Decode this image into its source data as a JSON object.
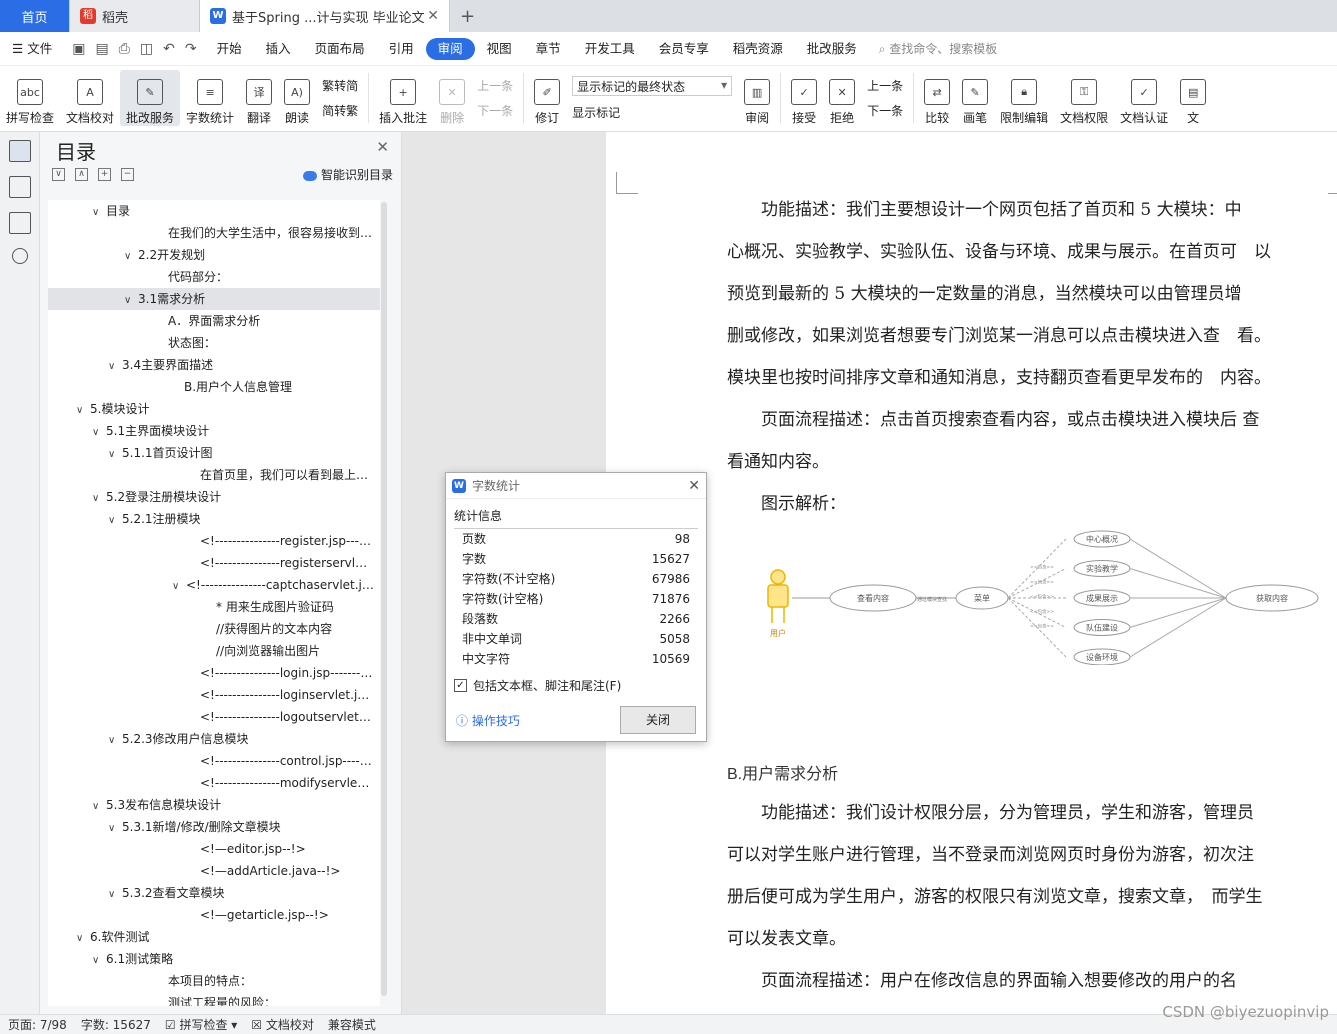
{
  "tabs": {
    "home": "首页",
    "daoke": "稻壳",
    "doc": "基于Spring ...计与实现 毕业论文"
  },
  "menu": {
    "file": "文件",
    "items": [
      "开始",
      "插入",
      "页面布局",
      "引用",
      "审阅",
      "视图",
      "章节",
      "开发工具",
      "会员专享",
      "稻壳资源",
      "批改服务"
    ],
    "active": "审阅",
    "search": "查找命令、搜索模板"
  },
  "ribbon": {
    "spell": "拼写检查",
    "doc_check": "文档校对",
    "correct": "批改服务",
    "word_count": "字数统计",
    "translate": "翻译",
    "read": "朗读",
    "to_trad": "繁转简",
    "to_simp": "简转繁",
    "insert_comment": "插入批注",
    "delete": "删除",
    "prev1": "上一条",
    "next1": "下一条",
    "revise": "修订",
    "show_state": "显示标记的最终状态",
    "show_mark": "显示标记",
    "review": "审阅",
    "accept": "接受",
    "reject": "拒绝",
    "prev2": "上一条",
    "next2": "下一条",
    "compare": "比较",
    "pen": "画笔",
    "limit_edit": "限制编辑",
    "doc_perm": "文档权限",
    "doc_auth": "文档认证",
    "more": "文"
  },
  "toc": {
    "title": "目录",
    "smart": "智能识别目录",
    "items": [
      {
        "label": "目录",
        "arrow": "∨",
        "indent": 44
      },
      {
        "label": "在我们的大学生活中，很容易接收到不同渠道的消息",
        "arrow": "",
        "indent": 106
      },
      {
        "label": "2.2开发规划",
        "arrow": "∨",
        "indent": 76
      },
      {
        "label": "代码部分：",
        "arrow": "",
        "indent": 106
      },
      {
        "label": "3.1需求分析",
        "arrow": "∨",
        "indent": 76,
        "selected": true
      },
      {
        "label": "A．界面需求分析",
        "arrow": "",
        "indent": 106
      },
      {
        "label": "状态图：",
        "arrow": "",
        "indent": 106
      },
      {
        "label": "3.4主要界面描述",
        "arrow": "∨",
        "indent": 60
      },
      {
        "label": "B.用户个人信息管理",
        "arrow": "",
        "indent": 122
      },
      {
        "label": "5.模块设计",
        "arrow": "∨",
        "indent": 28
      },
      {
        "label": "5.1主界面模块设计",
        "arrow": "∨",
        "indent": 44
      },
      {
        "label": "5.1.1首页设计图",
        "arrow": "∨",
        "indent": 60
      },
      {
        "label": "在首页里，我们可以看到最上方的导航栏",
        "arrow": "",
        "indent": 138
      },
      {
        "label": "5.2登录注册模块设计",
        "arrow": "∨",
        "indent": 44
      },
      {
        "label": "5.2.1注册模块",
        "arrow": "∨",
        "indent": 60
      },
      {
        "label": "<!---------------register.jsp-------------->",
        "arrow": "",
        "indent": 138
      },
      {
        "label": "<!---------------registerservlet.java-------->",
        "arrow": "",
        "indent": 138
      },
      {
        "label": "<!---------------captchaservlet.java-------->",
        "arrow": "∨",
        "indent": 124
      },
      {
        "label": "* 用来生成图片验证码",
        "arrow": "",
        "indent": 154
      },
      {
        "label": "//获得图片的文本内容",
        "arrow": "",
        "indent": 154
      },
      {
        "label": "//向浏览器输出图片",
        "arrow": "",
        "indent": 154
      },
      {
        "label": "<!---------------login.jsp---------------->",
        "arrow": "",
        "indent": 138
      },
      {
        "label": "<!---------------loginservlet.java---------->",
        "arrow": "",
        "indent": 138
      },
      {
        "label": "<!---------------logoutservlet-------------->",
        "arrow": "",
        "indent": 138
      },
      {
        "label": "5.2.3修改用户信息模块",
        "arrow": "∨",
        "indent": 60
      },
      {
        "label": "<!---------------control.jsp---------------->",
        "arrow": "",
        "indent": 138
      },
      {
        "label": "<!---------------modifyservlet.java-------->",
        "arrow": "",
        "indent": 138
      },
      {
        "label": "5.3发布信息模块设计",
        "arrow": "∨",
        "indent": 44
      },
      {
        "label": "5.3.1新增/修改/删除文章模块",
        "arrow": "∨",
        "indent": 60
      },
      {
        "label": "<!—editor.jsp--!>",
        "arrow": "",
        "indent": 138
      },
      {
        "label": "<!—addArticle.java--!>",
        "arrow": "",
        "indent": 138
      },
      {
        "label": "5.3.2查看文章模块",
        "arrow": "∨",
        "indent": 60
      },
      {
        "label": "<!—getarticle.jsp--!>",
        "arrow": "",
        "indent": 138
      },
      {
        "label": "6.软件测试",
        "arrow": "∨",
        "indent": 28
      },
      {
        "label": "6.1测试策略",
        "arrow": "∨",
        "indent": 44
      },
      {
        "label": "本项目的特点：",
        "arrow": "",
        "indent": 106
      },
      {
        "label": "测试工程量的风险：",
        "arrow": "",
        "indent": 106
      }
    ]
  },
  "doc": {
    "p1": [
      "　　功能描述：我们主要想设计一个网页包括了首页和 5 大模块：中",
      "心概况、实验教学、实验队伍、设备与环境、成果与展示。在首页可　以",
      "预览到最新的 5 大模块的一定数量的消息，当然模块可以由管理员增",
      "删或修改，如果浏览者想要专门浏览某一消息可以点击模块进入查　看。",
      "模块里也按时间排序文章和通知消息，支持翻页查看更早发布的　内容。"
    ],
    "p2": [
      "　　页面流程描述：点击首页搜索查看内容，或点击模块进入模块后 查",
      "看通知内容。"
    ],
    "p3": "　　图示解析：",
    "heading_b": "B.用户需求分析",
    "p4": [
      "　　功能描述：我们设计权限分层，分为管理员，学生和游客，管理员",
      "可以对学生账户进行管理，当不登录而浏览网页时身份为游客，初次注",
      "册后便可成为学生用户，游客的权限只有浏览文章，搜索文章，　而学生",
      "可以发表文章。"
    ],
    "p5": "　　页面流程描述：用户在修改信息的界面输入想要修改的用户的名"
  },
  "diagram": {
    "actor": "用户",
    "view": "查看内容",
    "via": "通过模块查找",
    "menu": "菜单",
    "include": "<<包含>>",
    "modules": [
      "中心概况",
      "实验教学",
      "成果展示",
      "队伍建设",
      "设备环境"
    ],
    "result": "获取内容"
  },
  "dialog": {
    "title": "字数统计",
    "subtitle": "统计信息",
    "rows": [
      {
        "k": "页数",
        "v": "98"
      },
      {
        "k": "字数",
        "v": "15627"
      },
      {
        "k": "字符数(不计空格)",
        "v": "67986"
      },
      {
        "k": "字符数(计空格)",
        "v": "71876"
      },
      {
        "k": "段落数",
        "v": "2266"
      },
      {
        "k": "非中文单词",
        "v": "5058"
      },
      {
        "k": "中文字符",
        "v": "10569"
      }
    ],
    "check": "包括文本框、脚注和尾注(F)",
    "tips": "操作技巧",
    "close": "关闭"
  },
  "status": {
    "page": "页面: 7/98",
    "words": "字数: 15627",
    "spell": "拼写检查",
    "proof": "文档校对",
    "compat": "兼容模式"
  },
  "watermark": "CSDN @biyezuopinvip"
}
